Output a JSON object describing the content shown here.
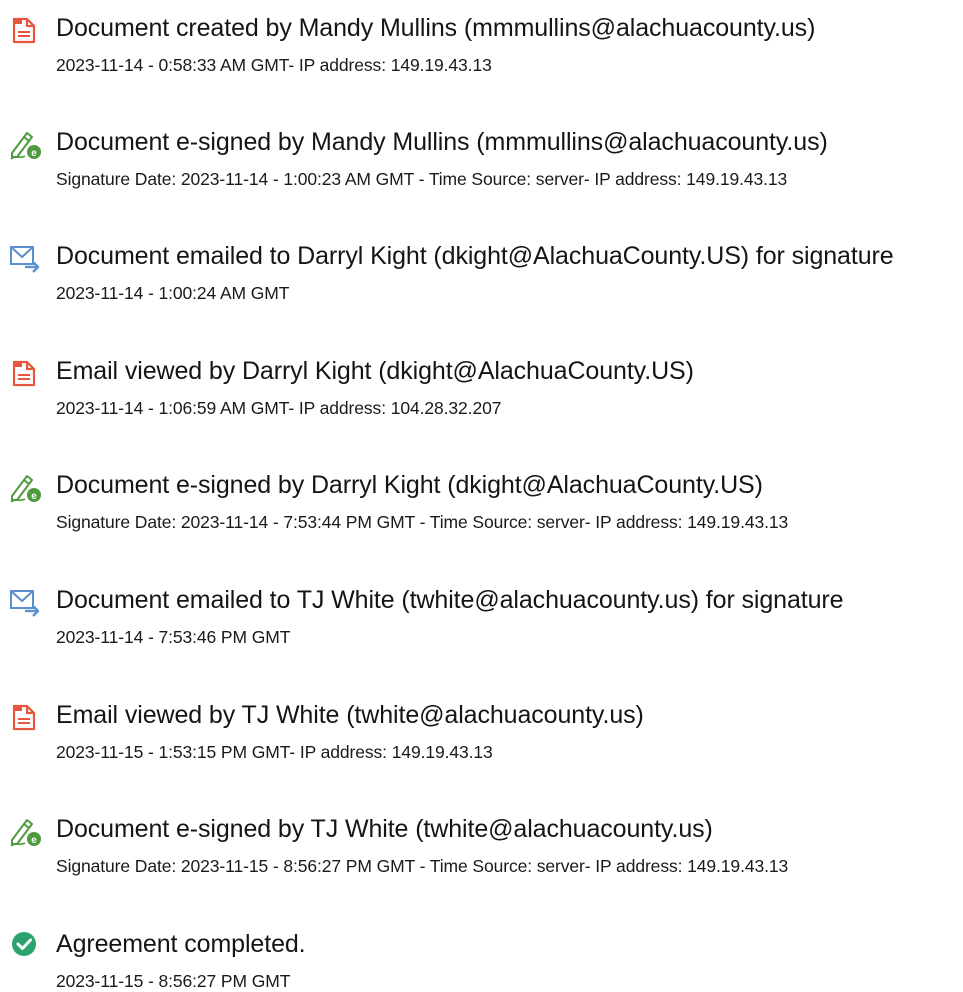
{
  "events": [
    {
      "icon": "document-created-icon",
      "title": "Document created by Mandy Mullins (mmmullins@alachuacounty.us)",
      "detail": "2023-11-14 - 0:58:33 AM GMT- IP address: 149.19.43.13"
    },
    {
      "icon": "e-sign-icon",
      "title": "Document e-signed by Mandy Mullins (mmmullins@alachuacounty.us)",
      "detail": "Signature Date: 2023-11-14 - 1:00:23 AM GMT - Time Source: server- IP address: 149.19.43.13"
    },
    {
      "icon": "email-sent-icon",
      "title": "Document emailed to Darryl Kight (dkight@AlachuaCounty.US) for signature",
      "detail": "2023-11-14 - 1:00:24 AM GMT"
    },
    {
      "icon": "email-viewed-icon",
      "title": "Email viewed by Darryl Kight (dkight@AlachuaCounty.US)",
      "detail": "2023-11-14 - 1:06:59 AM GMT- IP address: 104.28.32.207"
    },
    {
      "icon": "e-sign-icon",
      "title": "Document e-signed by Darryl Kight (dkight@AlachuaCounty.US)",
      "detail": "Signature Date: 2023-11-14 - 7:53:44 PM GMT - Time Source: server- IP address: 149.19.43.13"
    },
    {
      "icon": "email-sent-icon",
      "title": "Document emailed to TJ White (twhite@alachuacounty.us) for signature",
      "detail": "2023-11-14 - 7:53:46 PM GMT"
    },
    {
      "icon": "email-viewed-icon",
      "title": "Email viewed by TJ White (twhite@alachuacounty.us)",
      "detail": "2023-11-15 - 1:53:15 PM GMT- IP address: 149.19.43.13"
    },
    {
      "icon": "e-sign-icon",
      "title": "Document e-signed by TJ White (twhite@alachuacounty.us)",
      "detail": "Signature Date: 2023-11-15 - 8:56:27 PM GMT - Time Source: server- IP address: 149.19.43.13"
    },
    {
      "icon": "checkmark-icon",
      "title": "Agreement completed.",
      "detail": "2023-11-15 - 8:56:27 PM GMT"
    }
  ],
  "colors": {
    "doc_icon": "#e8553e",
    "esign_icon": "#4e9a3f",
    "email_icon": "#5b8fce",
    "complete_icon": "#2aa46c"
  }
}
